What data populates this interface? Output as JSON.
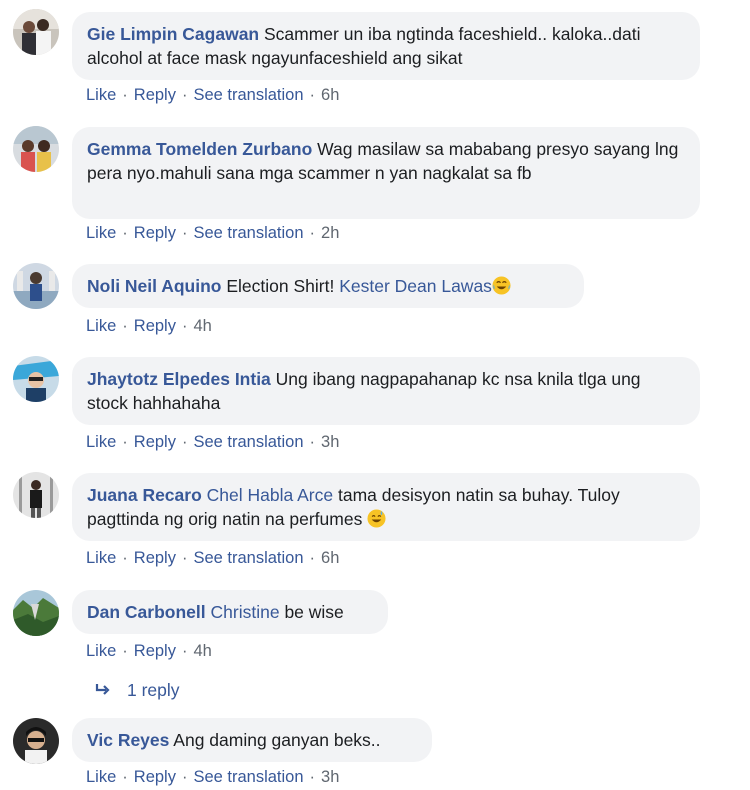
{
  "comments": [
    {
      "author": "Gie Limpin Cagawan",
      "text": "Scammer un iba ngtinda faceshield.. kaloka..dati alcohol at face mask ngayunfaceshield ang sikat",
      "actions": {
        "like": "Like",
        "reply": "Reply",
        "translate": "See translation",
        "time": "6h"
      }
    },
    {
      "author": "Gemma Tomelden Zurbano",
      "text": "Wag masilaw sa mababang presyo sayang lng pera nyo.mahuli sana mga scammer n yan nagkalat sa fb",
      "actions": {
        "like": "Like",
        "reply": "Reply",
        "translate": "See translation",
        "time": "2h"
      }
    },
    {
      "author": "Noli Neil Aquino",
      "text": "Election Shirt!",
      "mention": "Kester Dean Lawas",
      "emoji": "face-with-tears-of-joy-icon",
      "actions": {
        "like": "Like",
        "reply": "Reply",
        "time": "4h"
      }
    },
    {
      "author": "Jhaytotz Elpedes Intia",
      "text": "Ung ibang nagpapahanap kc nsa knila tlga ung stock hahhahaha",
      "actions": {
        "like": "Like",
        "reply": "Reply",
        "translate": "See translation",
        "time": "3h"
      }
    },
    {
      "author": "Juana Recaro",
      "mention": "Chel Habla Arce",
      "text": "tama desisyon natin sa buhay. Tuloy pagttinda ng orig natin na perfumes",
      "emoji": "grinning-sweat-face-icon",
      "actions": {
        "like": "Like",
        "reply": "Reply",
        "translate": "See translation",
        "time": "6h"
      }
    },
    {
      "author": "Dan Carbonell",
      "mention": "Christine",
      "text": "be wise",
      "actions": {
        "like": "Like",
        "reply": "Reply",
        "time": "4h"
      }
    },
    {
      "author": "Vic Reyes",
      "text": "Ang daming ganyan beks..",
      "actions": {
        "like": "Like",
        "reply": "Reply",
        "translate": "See translation",
        "time": "3h"
      }
    }
  ],
  "replies": {
    "label": "1 reply",
    "icon": "reply-arrow-icon"
  },
  "colors": {
    "author": "#385898",
    "bubble": "#f2f3f5",
    "meta": "#606770"
  }
}
